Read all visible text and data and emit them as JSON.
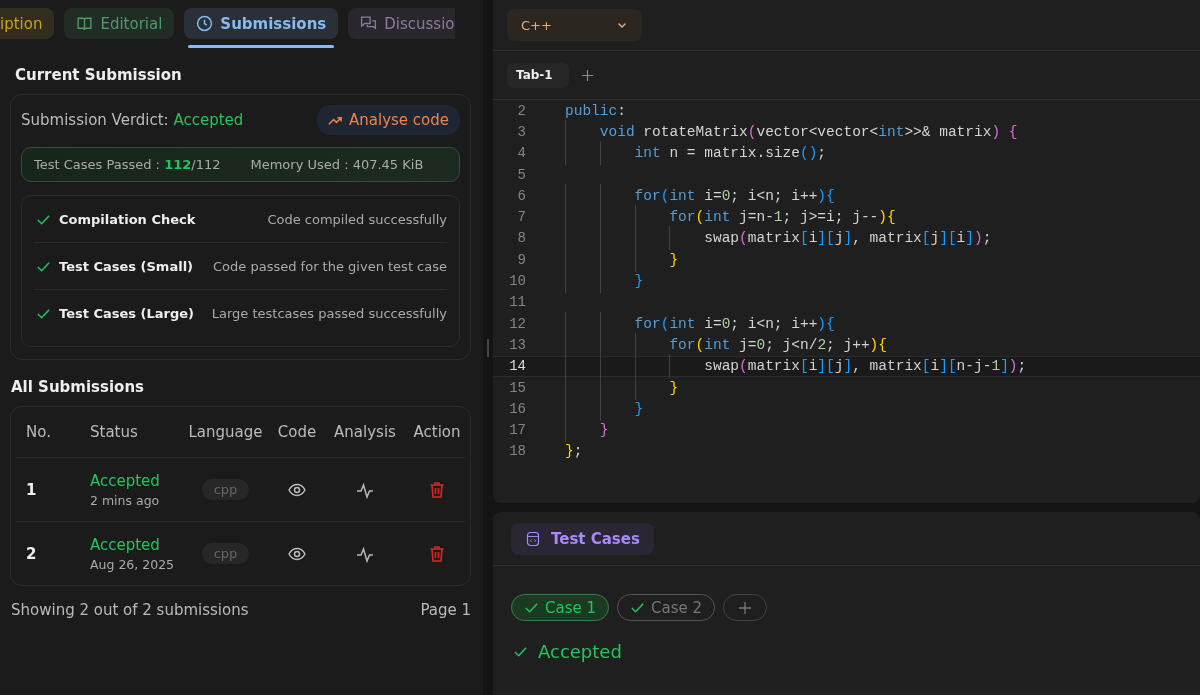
{
  "tabs": [
    {
      "label": "iption",
      "kind": "plain",
      "color": "#c9a227",
      "selected": false
    },
    {
      "label": "Editorial",
      "kind": "book",
      "color": "#4e9a6a",
      "selected": false
    },
    {
      "label": "Submissions",
      "kind": "clock",
      "color": "#8ab8f0",
      "selected": true
    },
    {
      "label": "Discussio",
      "kind": "chat",
      "color": "#8c7a9e",
      "selected": false
    }
  ],
  "current": {
    "title": "Current Submission",
    "verdict_label": "Submission Verdict:",
    "verdict": "Accepted",
    "analyse_button": "Analyse code",
    "passed_label": "Test Cases Passed :",
    "passed": "112",
    "total": "/112",
    "memory": "Memory Used : 407.45 KiB",
    "checks": [
      {
        "name": "Compilation Check",
        "detail": "Code compiled successfully",
        "passed": true
      },
      {
        "name": "Test Cases (Small)",
        "detail": "Code passed for the given test case",
        "passed": true
      },
      {
        "name": "Test Cases (Large)",
        "detail": "Large testcases passed successfully",
        "passed": true
      }
    ]
  },
  "all": {
    "title": "All Submissions",
    "columns": [
      "No.",
      "Status",
      "Language",
      "Code",
      "Analysis",
      "Action"
    ],
    "rows": [
      {
        "no": "1",
        "status": "Accepted",
        "time": "2 mins ago",
        "language": "cpp"
      },
      {
        "no": "2",
        "status": "Accepted",
        "time": "Aug 26, 2025",
        "language": "cpp"
      }
    ],
    "footer": "Showing 2 out of 2 submissions",
    "page": "Page 1"
  },
  "editor": {
    "language": "C++",
    "tabs": [
      {
        "label": "Tab-1",
        "selected": true
      }
    ],
    "lines": [
      {
        "no": "2",
        "current": false,
        "tokens": [
          {
            "kind": "k",
            "text": "public"
          },
          {
            "kind": "t",
            "text": ":"
          }
        ]
      },
      {
        "no": "3",
        "current": false,
        "tokens": [
          {
            "kind": "k",
            "text": "    void"
          },
          {
            "kind": "t",
            "text": " rotateMatrix"
          },
          {
            "kind": "b2",
            "text": "("
          },
          {
            "kind": "t",
            "text": "vector<vector<"
          },
          {
            "kind": "k",
            "text": "int"
          },
          {
            "kind": "t",
            "text": ">>& matrix"
          },
          {
            "kind": "b2",
            "text": ") {"
          }
        ]
      },
      {
        "no": "4",
        "current": false,
        "tokens": [
          {
            "kind": "k",
            "text": "        int"
          },
          {
            "kind": "t",
            "text": " n = matrix.size"
          },
          {
            "kind": "b3",
            "text": "()"
          },
          {
            "kind": "t",
            "text": ";"
          }
        ]
      },
      {
        "no": "5",
        "current": false
      },
      {
        "no": "6",
        "current": false,
        "tokens": [
          {
            "kind": "k",
            "text": "        for"
          },
          {
            "kind": "b3",
            "text": "("
          },
          {
            "kind": "k",
            "text": "int"
          },
          {
            "kind": "t",
            "text": " i="
          },
          {
            "kind": "n",
            "text": "0"
          },
          {
            "kind": "t",
            "text": "; i<n; i++"
          },
          {
            "kind": "b3",
            "text": "){"
          }
        ]
      },
      {
        "no": "7",
        "current": false,
        "tokens": [
          {
            "kind": "k",
            "text": "            for"
          },
          {
            "kind": "b1",
            "text": "("
          },
          {
            "kind": "k",
            "text": "int"
          },
          {
            "kind": "t",
            "text": " j=n-"
          },
          {
            "kind": "n",
            "text": "1"
          },
          {
            "kind": "t",
            "text": "; j>=i; j--"
          },
          {
            "kind": "b1",
            "text": "){"
          }
        ]
      },
      {
        "no": "8",
        "current": false,
        "tokens": [
          {
            "kind": "t",
            "text": "                swap"
          },
          {
            "kind": "b2",
            "text": "("
          },
          {
            "kind": "t",
            "text": "matrix"
          },
          {
            "kind": "b3",
            "text": "["
          },
          {
            "kind": "t",
            "text": "i"
          },
          {
            "kind": "b3",
            "text": "]["
          },
          {
            "kind": "t",
            "text": "j"
          },
          {
            "kind": "b3",
            "text": "]"
          },
          {
            "kind": "t",
            "text": ", matrix"
          },
          {
            "kind": "b3",
            "text": "["
          },
          {
            "kind": "t",
            "text": "j"
          },
          {
            "kind": "b3",
            "text": "]["
          },
          {
            "kind": "t",
            "text": "i"
          },
          {
            "kind": "b3",
            "text": "]"
          },
          {
            "kind": "b2",
            "text": ")"
          },
          {
            "kind": "t",
            "text": ";"
          }
        ]
      },
      {
        "no": "9",
        "current": false,
        "tokens": [
          {
            "kind": "b1",
            "text": "            }"
          }
        ]
      },
      {
        "no": "10",
        "current": false,
        "tokens": [
          {
            "kind": "b3",
            "text": "        }"
          }
        ]
      },
      {
        "no": "11",
        "current": false
      },
      {
        "no": "12",
        "current": false,
        "tokens": [
          {
            "kind": "k",
            "text": "        for"
          },
          {
            "kind": "b3",
            "text": "("
          },
          {
            "kind": "k",
            "text": "int"
          },
          {
            "kind": "t",
            "text": " i="
          },
          {
            "kind": "n",
            "text": "0"
          },
          {
            "kind": "t",
            "text": "; i<n; i++"
          },
          {
            "kind": "b3",
            "text": "){"
          }
        ]
      },
      {
        "no": "13",
        "current": false,
        "tokens": [
          {
            "kind": "k",
            "text": "            for"
          },
          {
            "kind": "b1",
            "text": "("
          },
          {
            "kind": "k",
            "text": "int"
          },
          {
            "kind": "t",
            "text": " j="
          },
          {
            "kind": "n",
            "text": "0"
          },
          {
            "kind": "t",
            "text": "; j<n/"
          },
          {
            "kind": "n",
            "text": "2"
          },
          {
            "kind": "t",
            "text": "; j++"
          },
          {
            "kind": "b1",
            "text": "){"
          }
        ]
      },
      {
        "no": "14",
        "current": true,
        "tokens": [
          {
            "kind": "t",
            "text": "                swap"
          },
          {
            "kind": "b2",
            "text": "("
          },
          {
            "kind": "t",
            "text": "matrix"
          },
          {
            "kind": "b3",
            "text": "["
          },
          {
            "kind": "t",
            "text": "i"
          },
          {
            "kind": "b3",
            "text": "]["
          },
          {
            "kind": "t",
            "text": "j"
          },
          {
            "kind": "b3",
            "text": "]"
          },
          {
            "kind": "t",
            "text": ", matrix"
          },
          {
            "kind": "b3",
            "text": "["
          },
          {
            "kind": "t",
            "text": "i"
          },
          {
            "kind": "b3",
            "text": "]["
          },
          {
            "kind": "t",
            "text": "n-j-"
          },
          {
            "kind": "n",
            "text": "1"
          },
          {
            "kind": "b3",
            "text": "]"
          },
          {
            "kind": "b2",
            "text": ")"
          },
          {
            "kind": "t",
            "text": ";"
          }
        ]
      },
      {
        "no": "15",
        "current": false,
        "tokens": [
          {
            "kind": "b1",
            "text": "            }"
          }
        ]
      },
      {
        "no": "16",
        "current": false,
        "tokens": [
          {
            "kind": "b3",
            "text": "        }"
          }
        ]
      },
      {
        "no": "17",
        "current": false,
        "tokens": [
          {
            "kind": "b2",
            "text": "    }"
          }
        ]
      },
      {
        "no": "18",
        "current": false,
        "tokens": [
          {
            "kind": "b1",
            "text": "}"
          },
          {
            "kind": "t",
            "text": ";"
          }
        ]
      }
    ]
  },
  "testcases": {
    "title": "Test Cases",
    "cases": [
      {
        "label": "Case 1",
        "selected": true
      },
      {
        "label": "Case 2",
        "selected": false
      }
    ],
    "result": "Accepted"
  }
}
